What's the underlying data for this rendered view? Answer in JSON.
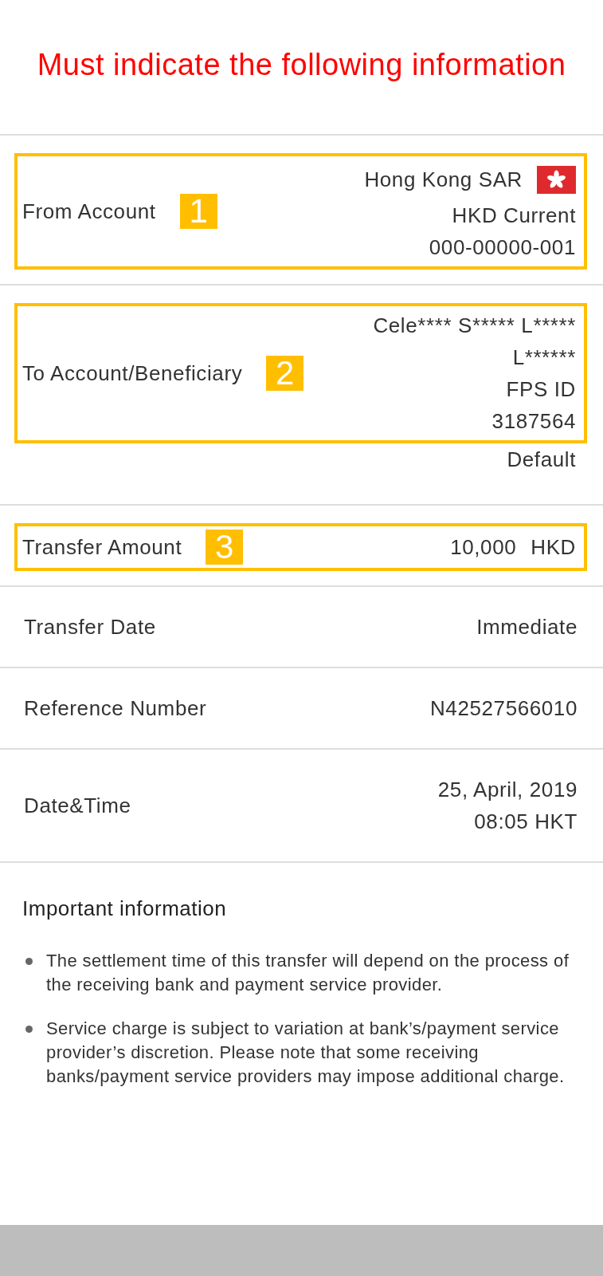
{
  "title": "Must indicate the following information",
  "rows": [
    {
      "label": "From Account",
      "highlighted": true,
      "marker": "1",
      "lines": [
        {
          "text": "Hong Kong SAR",
          "flag": true
        },
        {
          "text": "HKD Current",
          "flag": false
        },
        {
          "text": "000-00000-001",
          "flag": false
        }
      ]
    },
    {
      "label": "To Account/Beneficiary",
      "highlighted": true,
      "marker": "2",
      "lines": [
        {
          "text": "Cele**** S***** L*****",
          "flag": false
        },
        {
          "text": "L******",
          "flag": false
        },
        {
          "text": "FPS ID",
          "flag": false
        },
        {
          "text": "3187564",
          "flag": false
        }
      ],
      "note": "Default"
    },
    {
      "label": "Transfer Amount",
      "highlighted": true,
      "marker": "3",
      "lines": [
        {
          "text": "10,000",
          "unit": "HKD",
          "flag": false
        }
      ]
    },
    {
      "label": "Transfer Date",
      "highlighted": false,
      "lines": [
        {
          "text": "Immediate",
          "flag": false
        }
      ]
    },
    {
      "label": "Reference Number",
      "highlighted": false,
      "lines": [
        {
          "text": "N42527566010",
          "flag": false
        }
      ]
    },
    {
      "label": "Date&Time",
      "highlighted": false,
      "lines": [
        {
          "text": "25, April, 2019",
          "flag": false
        },
        {
          "text": "08:05 HKT",
          "flag": false
        }
      ]
    }
  ],
  "important": {
    "heading": "Important information",
    "items": [
      "The settlement time of this transfer will depend on the process of the receiving bank and payment service provider.",
      "Service charge is subject to variation at bank’s/payment service provider’s discretion. Please note that some receiving banks/payment service providers may impose additional charge."
    ]
  }
}
